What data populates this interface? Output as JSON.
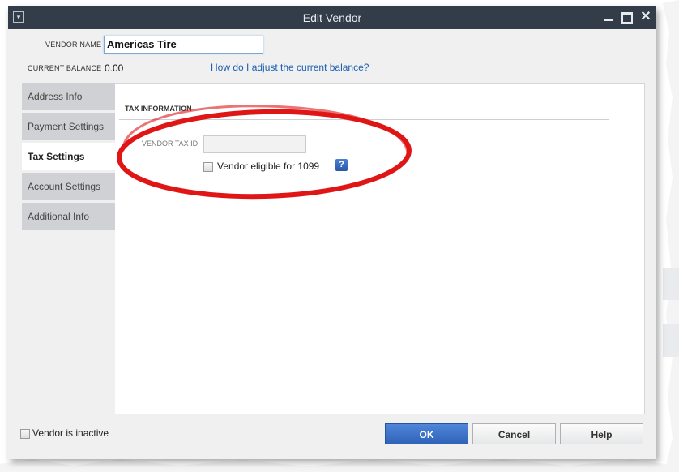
{
  "window": {
    "title": "Edit Vendor"
  },
  "vendor_name": {
    "label": "VENDOR NAME",
    "value": "Americas Tire"
  },
  "current_balance": {
    "label": "CURRENT BALANCE",
    "value": "0.00",
    "link": "How do I adjust the current balance?"
  },
  "tabs": [
    {
      "label": "Address Info",
      "active": false
    },
    {
      "label": "Payment Settings",
      "active": false
    },
    {
      "label": "Tax Settings",
      "active": true
    },
    {
      "label": "Account Settings",
      "active": false
    },
    {
      "label": "Additional Info",
      "active": false
    }
  ],
  "tax_section": {
    "title": "TAX INFORMATION",
    "tax_id_label": "VENDOR TAX ID",
    "tax_id_value": "",
    "eligible_1099_label": "Vendor eligible for 1099",
    "eligible_1099_checked": false,
    "help_glyph": "?"
  },
  "footer": {
    "inactive_label": "Vendor is inactive",
    "inactive_checked": false,
    "ok_label": "OK",
    "cancel_label": "Cancel",
    "help_label": "Help"
  },
  "colors": {
    "titlebar": "#333d4a",
    "ok_button": "#3a6fc4",
    "annotation": "#e01515",
    "link": "#1a5fb0"
  }
}
